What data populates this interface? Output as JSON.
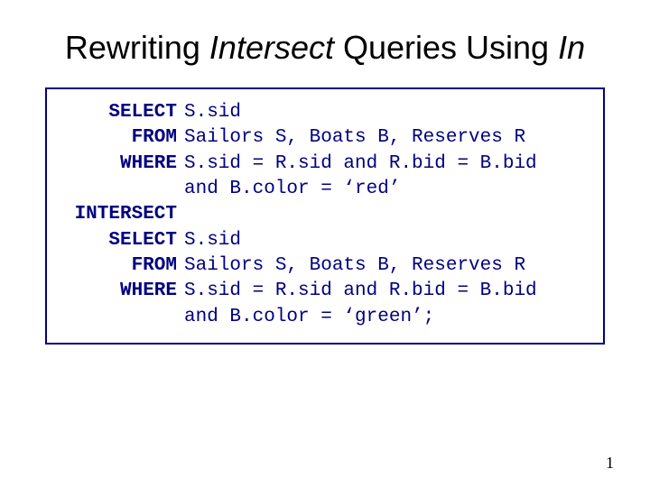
{
  "title": {
    "part1": "Rewriting ",
    "italic1": "Intersect",
    "part2": " Queries Using ",
    "italic2": "In"
  },
  "sql": {
    "q1": {
      "select_kw": "SELECT",
      "select": "S.sid",
      "from_kw": "FROM",
      "from": "Sailors S, Boats B, Reserves R",
      "where_kw": "WHERE",
      "where1": "S.sid = R.sid and R.bid = B.bid",
      "where2": "and B.color = ‘red’"
    },
    "intersect_kw": "INTERSECT",
    "q2": {
      "select_kw": "SELECT",
      "select": "S.sid",
      "from_kw": "FROM",
      "from": "Sailors S, Boats B, Reserves R",
      "where_kw": "WHERE",
      "where1": "S.sid = R.sid and R.bid = B.bid",
      "where2": "and B.color = ‘green’;"
    }
  },
  "page_number": "1"
}
